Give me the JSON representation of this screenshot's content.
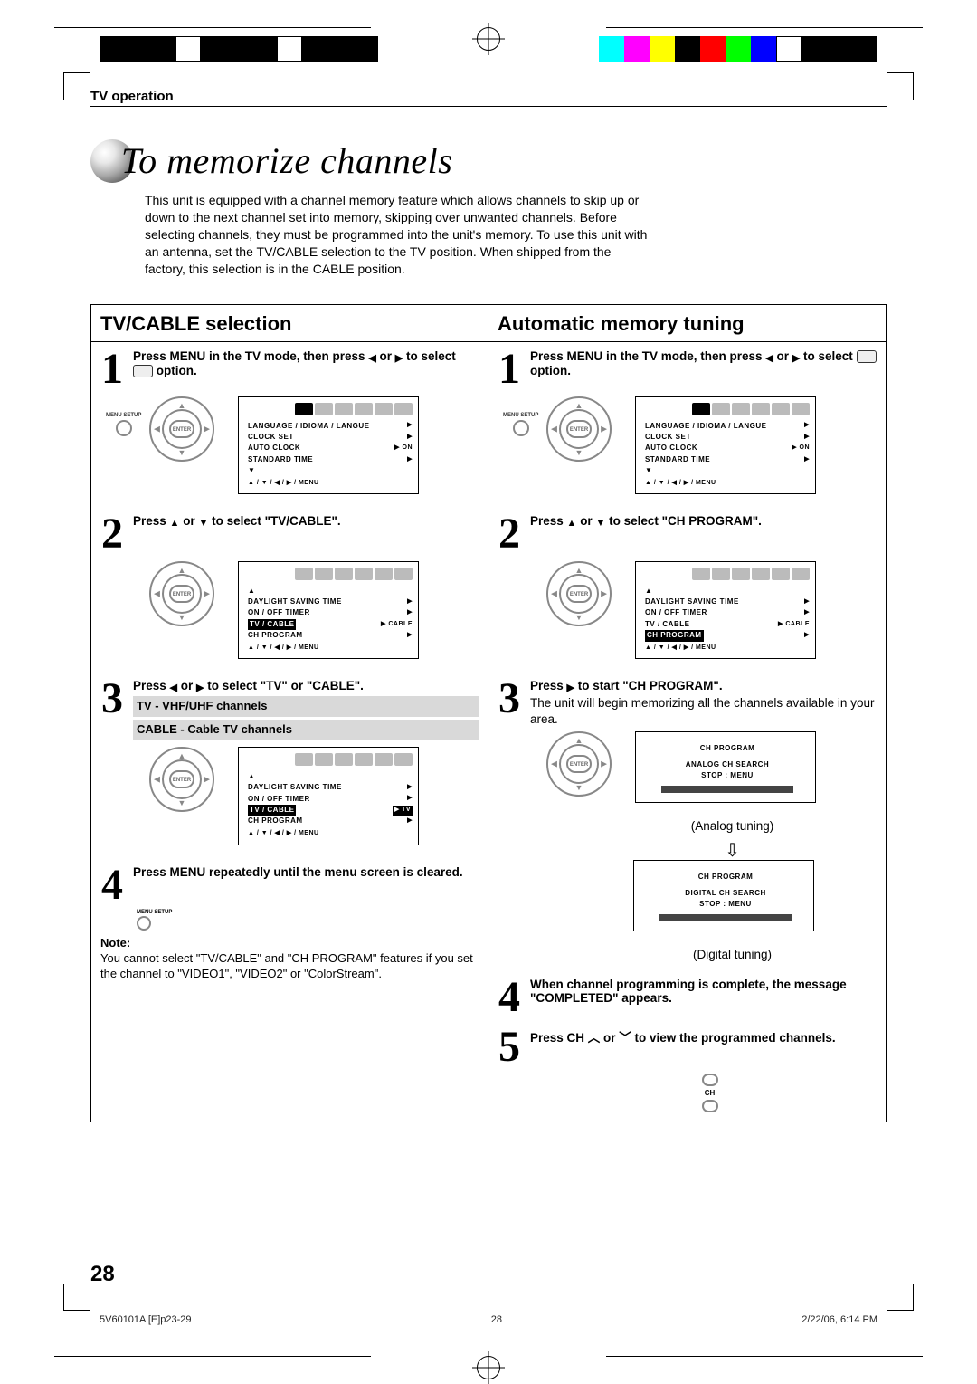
{
  "header": {
    "section_label": "TV operation"
  },
  "title": "To memorize channels",
  "intro": "This unit is equipped with a channel memory feature which allows channels to skip up or down to the next channel set into memory, skipping over unwanted channels. Before selecting channels, they must be programmed into the unit's memory. To use this unit with an antenna, set the TV/CABLE selection to the TV position. When shipped from the factory, this selection is in the CABLE position.",
  "left": {
    "heading": "TV/CABLE selection",
    "step1": "Press MENU in the TV mode, then press ◀ or ▶ to select  option.",
    "step2": "Press ▲ or ▼ to select \"TV/CABLE\".",
    "step3": "Press ◀ or ▶ to select \"TV\" or \"CABLE\".",
    "step3_box1": "TV - VHF/UHF channels",
    "step3_box2": "CABLE - Cable TV channels",
    "step4": "Press MENU repeatedly until the menu screen is cleared.",
    "note_label": "Note:",
    "note": "You cannot select \"TV/CABLE\" and \"CH PROGRAM\" features if you set the channel to \"VIDEO1\", \"VIDEO2\" or \"ColorStream\"."
  },
  "right": {
    "heading": "Automatic memory tuning",
    "step1": "Press MENU in the TV mode, then press ◀ or ▶ to select  option.",
    "step2": "Press ▲ or ▼ to select \"CH PROGRAM\".",
    "step3": "Press ▶ to start \"CH PROGRAM\".",
    "step3_extra": "The unit will begin memorizing all the channels available in your area.",
    "caption_analog": "(Analog tuning)",
    "caption_digital": "(Digital tuning)",
    "step4": "When channel programming is complete, the message \"COMPLETED\" appears.",
    "step5": "Press CH ︿ or ﹀ to view the programmed channels."
  },
  "osd": {
    "menu1": {
      "language": "LANGUAGE / IDIOMA / LANGUE",
      "clock_set": "CLOCK SET",
      "auto_clock": "AUTO CLOCK",
      "auto_clock_val": "▶ ON",
      "standard_time": "STANDARD TIME",
      "nav": "▲ / ▼ / ◀ / ▶ / MENU"
    },
    "menu2": {
      "up": "▲",
      "daylight": "DAYLIGHT SAVING TIME",
      "onoff": "ON / OFF TIMER",
      "tvcable": "TV / CABLE",
      "tvcable_val": "▶ CABLE",
      "chprog": "CH PROGRAM",
      "nav": "▲ / ▼ / ◀ / ▶ / MENU"
    },
    "menu3": {
      "tvcable_val": "▶ TV"
    },
    "chprog_analog": {
      "title": "CH PROGRAM",
      "sub": "ANALOG CH SEARCH",
      "stop": "STOP : MENU"
    },
    "chprog_digital": {
      "title": "CH PROGRAM",
      "sub": "DIGITAL CH SEARCH",
      "stop": "STOP : MENU"
    }
  },
  "remote": {
    "menu_label": "MENU SETUP",
    "enter": "ENTER",
    "ch": "CH"
  },
  "page_number": "28",
  "footer": {
    "file": "5V60101A [E]p23-29",
    "page": "28",
    "date": "2/22/06, 6:14 PM"
  }
}
